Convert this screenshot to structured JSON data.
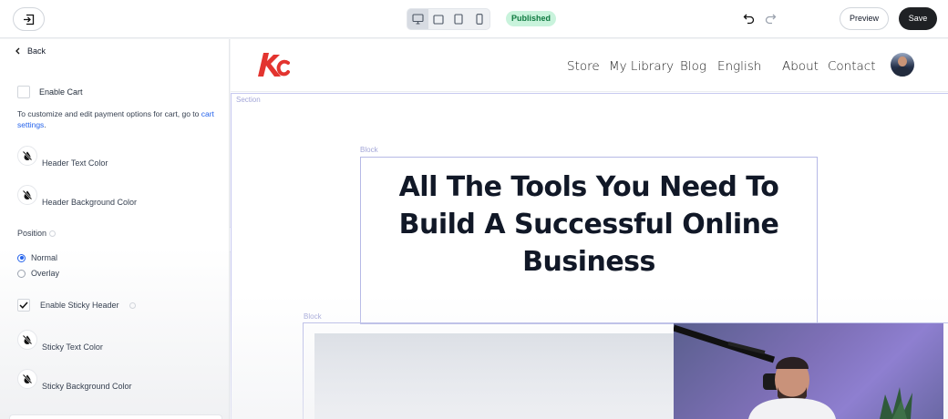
{
  "topbar": {
    "status": "Published",
    "preview_label": "Preview",
    "save_label": "Save",
    "devices": [
      "desktop-icon",
      "tablet-landscape-icon",
      "tablet-portrait-icon",
      "mobile-icon"
    ],
    "active_device": "desktop",
    "status_color": "#0f7a40"
  },
  "panel": {
    "back_label": "Back",
    "enable_cart_label": "Enable Cart",
    "enable_cart_checked": false,
    "cart_info_text": "To customize and edit payment options for cart, go to ",
    "cart_link_text": "cart settings",
    "cart_info_end": ".",
    "header_text_color_label": "Header Text Color",
    "header_bg_color_label": "Header Background Color",
    "position_label": "Position",
    "position_options": [
      "Normal",
      "Overlay"
    ],
    "position_selected": "Normal",
    "sticky_header_label": "Enable Sticky Header",
    "sticky_header_checked": true,
    "sticky_text_color_label": "Sticky Text Color",
    "sticky_bg_color_label": "Sticky Background Color"
  },
  "canvas": {
    "nav": [
      "Store",
      "My Library",
      "Blog",
      "English",
      "About",
      "Contact"
    ],
    "section_tag": "Section",
    "block_tag": "Block",
    "hero_lines": [
      "All The Tools You Need To",
      "Build A Successful Online",
      "Business"
    ],
    "logo_color": "#e3342f"
  },
  "colors": {
    "accent": "#2563eb",
    "save_bg": "#1f2124",
    "outline": "#b6b9e6"
  }
}
